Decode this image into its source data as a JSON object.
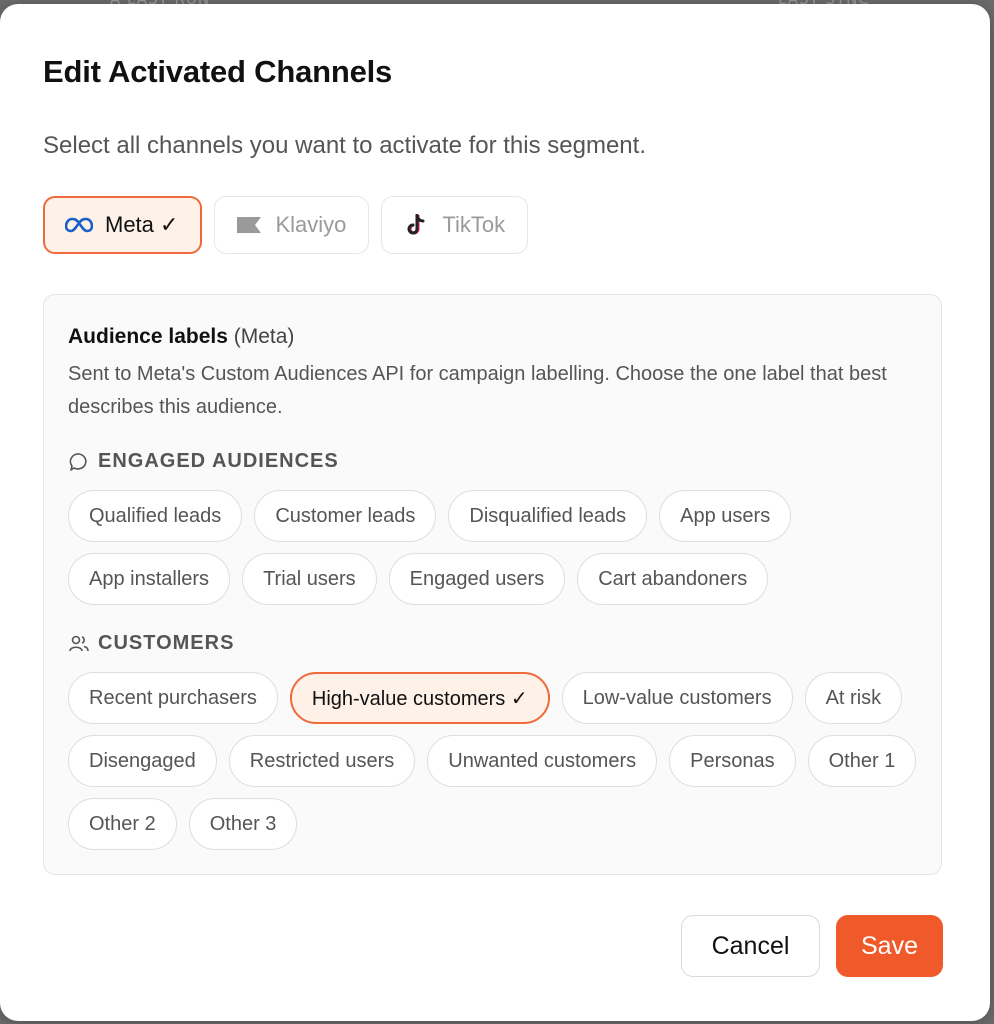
{
  "backdrop": {
    "left_text": "A LAST RUN",
    "right_text": "LAST SYNC"
  },
  "modal": {
    "title": "Edit Activated Channels",
    "subtitle": "Select all channels you want to activate for this segment."
  },
  "channels": [
    {
      "label": "Meta ✓",
      "icon": "meta-infinity-icon",
      "active": true
    },
    {
      "label": "Klaviyo",
      "icon": "klaviyo-flag-icon",
      "active": false
    },
    {
      "label": "TikTok",
      "icon": "tiktok-note-icon",
      "active": false
    }
  ],
  "panel": {
    "heading": "Audience labels",
    "heading_suffix": "(Meta)",
    "description": "Sent to Meta's Custom Audiences API for campaign labelling. Choose the one label that best describes this audience.",
    "engaged": {
      "label": "ENGAGED AUDIENCES",
      "icon": "speech-bubble-icon",
      "chips": [
        "Qualified leads",
        "Customer leads",
        "Disqualified leads",
        "App users",
        "App installers",
        "Trial users",
        "Engaged users",
        "Cart abandoners"
      ]
    },
    "customers": {
      "label": "CUSTOMERS",
      "icon": "users-icon",
      "chips": [
        "Recent purchasers",
        "High-value customers ✓",
        "Low-value customers",
        "At risk",
        "Disengaged",
        "Restricted users",
        "Unwanted customers",
        "Personas",
        "Other 1",
        "Other 2",
        "Other 3"
      ],
      "selected_index": 1
    }
  },
  "actions": {
    "cancel_label": "Cancel",
    "save_label": "Save"
  },
  "colors": {
    "accent": "#f05a2a",
    "accent_border": "#ee6a3c",
    "accent_bg": "#fdf1e8"
  }
}
